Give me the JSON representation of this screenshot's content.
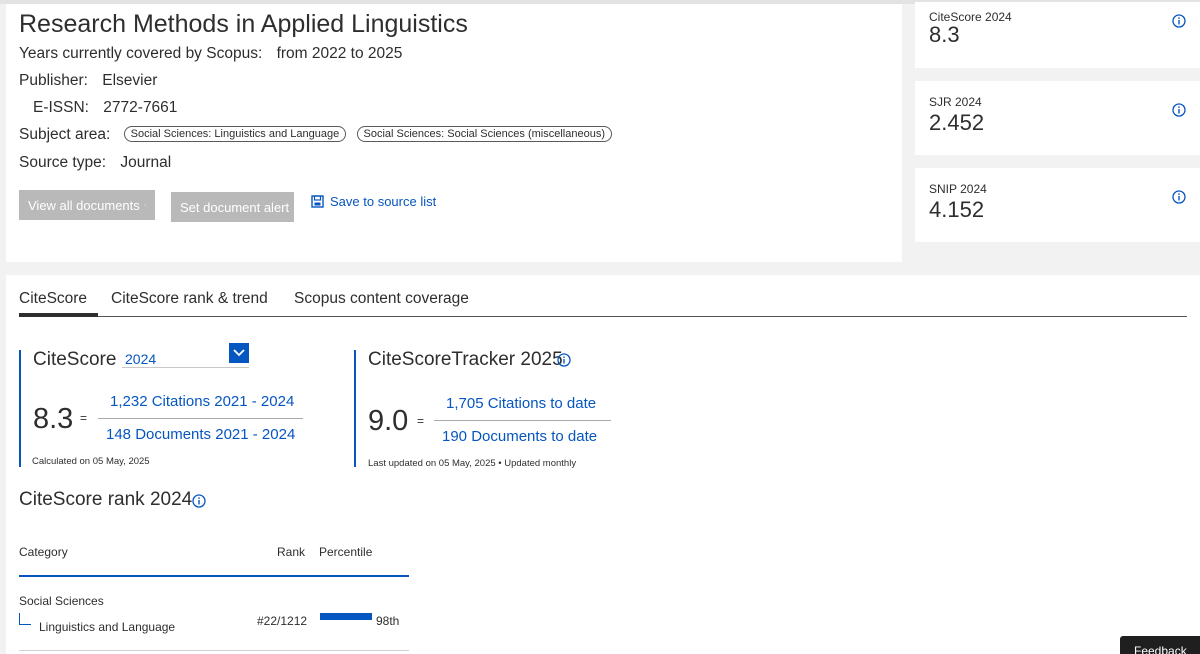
{
  "journal": {
    "title": "Research Methods in Applied Linguistics",
    "years_label": "Years currently covered by Scopus:",
    "years_value": "from 2022 to 2025",
    "publisher_label": "Publisher:",
    "publisher_value": "Elsevier",
    "eissn_label": "E-ISSN:",
    "eissn_value": "2772-7661",
    "subject_label": "Subject area:",
    "subjects": [
      "Social Sciences: Linguistics and Language",
      "Social Sciences: Social Sciences (miscellaneous)"
    ],
    "source_type_label": "Source type:",
    "source_type_value": "Journal"
  },
  "actions": {
    "view_all": "View all documents",
    "set_alert": "Set document alert",
    "save": "Save to source list"
  },
  "metrics": [
    {
      "label": "CiteScore 2024",
      "value": "8.3"
    },
    {
      "label": "SJR 2024",
      "value": "2.452"
    },
    {
      "label": "SNIP 2024",
      "value": "4.152"
    }
  ],
  "tabs": [
    "CiteScore",
    "CiteScore rank & trend",
    "Scopus content coverage"
  ],
  "citescore": {
    "heading": "CiteScore",
    "year": "2024",
    "value": "8.3",
    "equals": "=",
    "numerator": "1,232 Citations 2021 - 2024",
    "denominator": "148 Documents 2021 - 2024",
    "note": "Calculated on 05 May, 2025"
  },
  "tracker": {
    "heading": "CiteScoreTracker 2025",
    "value": "9.0",
    "equals": "=",
    "numerator": "1,705 Citations to date",
    "denominator": "190 Documents to date",
    "note": "Last updated on 05 May, 2025 • Updated monthly"
  },
  "rank": {
    "heading": "CiteScore rank 2024",
    "col_category": "Category",
    "col_rank": "Rank",
    "col_percentile": "Percentile",
    "rows": [
      {
        "category": "Social Sciences",
        "subcategory": "Linguistics and Language",
        "rank": "#22/1212",
        "percentile_label": "98th",
        "percentile": 98
      }
    ]
  },
  "feedback": "Feedback",
  "colors": {
    "accent": "#0656c1",
    "button_disabled": "#b9b9b9"
  }
}
